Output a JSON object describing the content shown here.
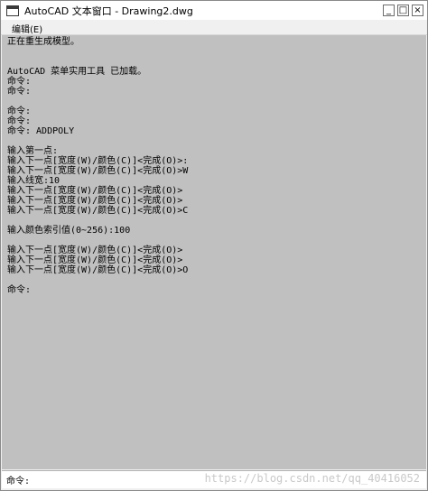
{
  "window": {
    "title": "AutoCAD 文本窗口 - Drawing2.dwg",
    "minimize_glyph": "_",
    "maximize_glyph": "□",
    "close_glyph": "×"
  },
  "menu": {
    "edit": "编辑(E)"
  },
  "log_lines": [
    "正在重生成模型。",
    "",
    "",
    "AutoCAD 菜单实用工具 已加载。",
    "命令:",
    "命令:",
    "",
    "命令:",
    "命令:",
    "命令: ADDPOLY",
    "",
    "输入第一点:",
    "输入下一点[宽度(W)/颜色(C)]<完成(O)>:",
    "输入下一点[宽度(W)/颜色(C)]<完成(O)>W",
    "输入线宽:10",
    "输入下一点[宽度(W)/颜色(C)]<完成(O)>",
    "输入下一点[宽度(W)/颜色(C)]<完成(O)>",
    "输入下一点[宽度(W)/颜色(C)]<完成(O)>C",
    "",
    "输入颜色索引值(0~256):100",
    "",
    "输入下一点[宽度(W)/颜色(C)]<完成(O)>",
    "输入下一点[宽度(W)/颜色(C)]<完成(O)>",
    "输入下一点[宽度(W)/颜色(C)]<完成(O)>O",
    "",
    "命令:"
  ],
  "command": {
    "prompt": "命令:",
    "value": ""
  },
  "watermark": "https://blog.csdn.net/qq_40416052",
  "icons": {
    "app": "text-window-icon",
    "minimize": "minimize-icon",
    "maximize": "maximize-icon",
    "close": "close-icon"
  },
  "colors": {
    "content_bg": "#c0c0c0",
    "chrome_bg": "#f0f0f0"
  }
}
